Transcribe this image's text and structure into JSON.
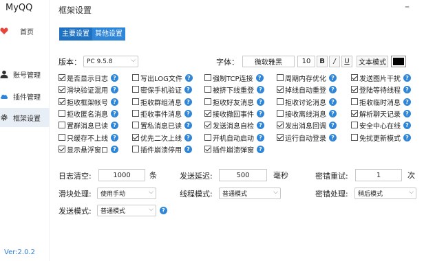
{
  "app": {
    "title": "MyQQ",
    "version": "Ver:2.0.2"
  },
  "sidebar": {
    "items": [
      {
        "label": "首页",
        "icon": "heart-icon"
      },
      {
        "label": "账号管理",
        "icon": "user-icon"
      },
      {
        "label": "插件管理",
        "icon": "cloud-icon"
      },
      {
        "label": "框架设置",
        "icon": "gear-icon"
      }
    ]
  },
  "header": {
    "title": "框架设置",
    "minimize": "–"
  },
  "tabs": [
    {
      "label": "主要设置"
    },
    {
      "label": "其他设置"
    }
  ],
  "version_row": {
    "label": "版本：",
    "value": "PC 9.5.8"
  },
  "font_row": {
    "label": "字体：",
    "font_name": "微软雅黑",
    "size": "10",
    "bold": "B",
    "italic": "/",
    "underline": "U",
    "text_mode": "文本模式",
    "color": "#000000"
  },
  "help_char": "?",
  "options": [
    [
      {
        "label": "是否显示日志",
        "checked": true
      },
      {
        "label": "写出LOG文件",
        "checked": false
      },
      {
        "label": "强制TCP连接",
        "checked": false
      },
      {
        "label": "周期内存优化",
        "checked": false
      },
      {
        "label": "发送图片干扰",
        "checked": true
      }
    ],
    [
      {
        "label": "滑块验证混用",
        "checked": true
      },
      {
        "label": "密保手机验证",
        "checked": false
      },
      {
        "label": "被挤下线重登",
        "checked": false
      },
      {
        "label": "掉线自动重登",
        "checked": true
      },
      {
        "label": "登陆等待线程",
        "checked": true
      }
    ],
    [
      {
        "label": "拒收框架帐号",
        "checked": true
      },
      {
        "label": "拒收群组消息",
        "checked": false
      },
      {
        "label": "拒收好友消息",
        "checked": false
      },
      {
        "label": "拒收讨论消息",
        "checked": false
      },
      {
        "label": "拒收临时消息",
        "checked": false
      }
    ],
    [
      {
        "label": "拒收匿名消息",
        "checked": false
      },
      {
        "label": "拒收事件消息",
        "checked": false
      },
      {
        "label": "接收撤回事件",
        "checked": true
      },
      {
        "label": "接收离线消息",
        "checked": false
      },
      {
        "label": "解析聊天记录",
        "checked": true
      }
    ],
    [
      {
        "label": "置群消息已读",
        "checked": false
      },
      {
        "label": "置私消息已读",
        "checked": false
      },
      {
        "label": "发送消息自检",
        "checked": true
      },
      {
        "label": "发出消息回调",
        "checked": true
      },
      {
        "label": "安全中心在线",
        "checked": false
      }
    ],
    [
      {
        "label": "只缓存不上线",
        "checked": false
      },
      {
        "label": "优先二次上线",
        "checked": true
      },
      {
        "label": "开机自动启动",
        "checked": false
      },
      {
        "label": "运行自动登录",
        "checked": true
      },
      {
        "label": "免扰更新模式",
        "checked": false
      }
    ],
    [
      {
        "label": "显示悬浮窗口",
        "checked": true
      },
      {
        "label": "插件崩溃停用",
        "checked": false
      },
      {
        "label": "插件崩溃弹窗",
        "checked": true
      }
    ]
  ],
  "settings": {
    "log_clear": {
      "label": "日志清空:",
      "value": "1000",
      "unit": "条"
    },
    "send_delay": {
      "label": "发送延迟:",
      "value": "500",
      "unit": "毫秒"
    },
    "pwd_retry": {
      "label": "密错重试:",
      "value": "1",
      "unit": "次"
    },
    "slider": {
      "label": "滑块处理:",
      "value": "使用手动"
    },
    "thread_mode": {
      "label": "线程模式:",
      "value": "普通模式"
    },
    "pwd_handle": {
      "label": "密错处理:",
      "value": "稍后模式"
    },
    "send_mode": {
      "label": "发送模式:",
      "value": "普通模式"
    }
  }
}
